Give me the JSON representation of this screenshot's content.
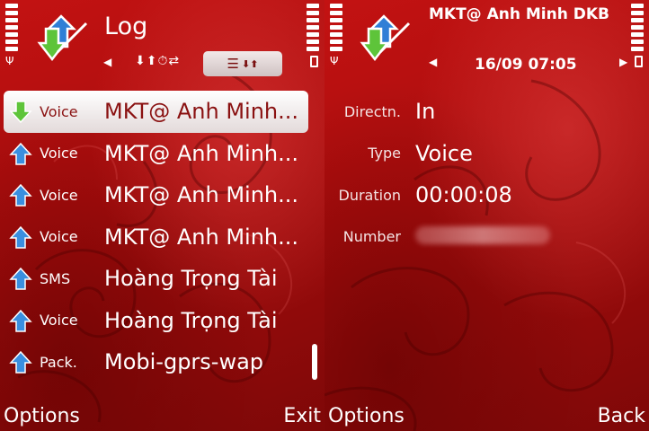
{
  "left": {
    "title": "Log",
    "filter_icons": "⬇⬆⏱⇄",
    "log_entries": [
      {
        "direction": "incoming",
        "type": "Voice",
        "name": "MKT@ Anh Minh...",
        "selected": true
      },
      {
        "direction": "outgoing",
        "type": "Voice",
        "name": "MKT@ Anh Minh...",
        "selected": false
      },
      {
        "direction": "outgoing",
        "type": "Voice",
        "name": "MKT@ Anh Minh...",
        "selected": false
      },
      {
        "direction": "outgoing",
        "type": "Voice",
        "name": "MKT@ Anh Minh...",
        "selected": false
      },
      {
        "direction": "outgoing",
        "type": "SMS",
        "name": "Hoàng Trọng Tài",
        "selected": false
      },
      {
        "direction": "outgoing",
        "type": "Voice",
        "name": "Hoàng Trọng Tài",
        "selected": false
      },
      {
        "direction": "outgoing",
        "type": "Pack.",
        "name": "Mobi-gprs-wap",
        "selected": false
      }
    ],
    "softkeys": {
      "left": "Options",
      "right": "Exit"
    }
  },
  "right": {
    "title": "MKT@ Anh Minh DKB",
    "datetime": "16/09 07:05",
    "details": [
      {
        "label": "Directn.",
        "value": "In"
      },
      {
        "label": "Type",
        "value": "Voice"
      },
      {
        "label": "Duration",
        "value": "00:00:08"
      },
      {
        "label": "Number",
        "value": ""
      }
    ],
    "softkeys": {
      "left": "Options",
      "right": "Back"
    }
  },
  "icons": {
    "incoming": "arrow-down-green",
    "outgoing": "arrow-up-blue"
  },
  "colors": {
    "background": "#b51010",
    "incoming_arrow": "#5ec43a",
    "outgoing_arrow": "#3a8fe0",
    "selected_text": "#8a1111"
  }
}
